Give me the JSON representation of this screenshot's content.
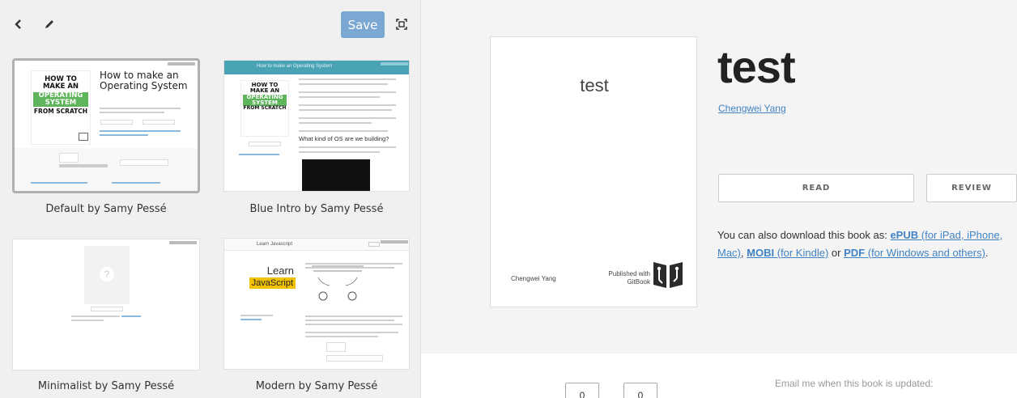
{
  "toolbar": {
    "back_icon": "chevron-left-icon",
    "edit_icon": "pencil-icon",
    "save_label": "Save",
    "fullscreen_icon": "expand-icon"
  },
  "themes": [
    {
      "label": "Default by Samy Pessé",
      "selected": true
    },
    {
      "label": "Blue Intro by Samy Pessé",
      "selected": false
    },
    {
      "label": "Minimalist by Samy Pessé",
      "selected": false
    },
    {
      "label": "Modern by Samy Pessé",
      "selected": false
    }
  ],
  "previews": {
    "default_heading": "How to make an Operating System",
    "default_cover_lines": [
      "HOW TO",
      "MAKE AN",
      "OPERATING",
      "SYSTEM",
      "FROM SCRATCH"
    ],
    "blue_header": "How to make an Operating System",
    "blue_section": "What kind of OS are we building?",
    "modern_header": "Learn Javascript",
    "modern_cover_top": "Learn",
    "modern_cover_bottom": "JavaScript"
  },
  "book": {
    "cover_title": "test",
    "cover_author": "Chengwei Yang",
    "cover_published": "Published with GitBook",
    "title": "test",
    "author": "Chengwei Yang",
    "read_label": "READ",
    "review_label": "REVIEW",
    "download_prefix": "You can also download this book as: ",
    "epub": "ePUB",
    "epub_note": " (for iPad, iPhone, Mac)",
    "mobi": "MOBI",
    "mobi_note": " (for Kindle)",
    "or": " or ",
    "pdf": "PDF",
    "pdf_note": " (for Windows and others)",
    "period": "."
  },
  "stats": {
    "count_a": "0",
    "count_b": "0",
    "email_text": "Email me when this book is updated:"
  },
  "colors": {
    "save_button": "#7ba7d3",
    "link": "#4183c4",
    "blue_intro_header": "#4aa3b5",
    "green_cover": "#5fb55c",
    "modern_yellow": "#f2c200"
  }
}
